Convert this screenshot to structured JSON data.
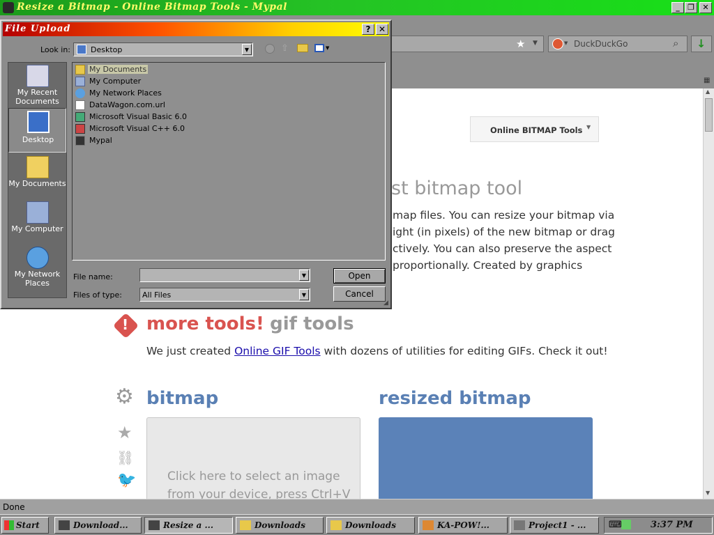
{
  "window": {
    "title": "Resize a Bitmap - Online Bitmap Tools - Mypal",
    "min_label": "_",
    "max_label": "❐",
    "close_label": "✕"
  },
  "toolbar": {
    "search_engine": "DuckDuckGo",
    "search_icon": "magnifier-icon",
    "bookmark_icon": "star-icon",
    "download_icon": "download-arrow-icon"
  },
  "page": {
    "dropdown_label": "Online BITMAP Tools",
    "heading_partial": "st bitmap tool",
    "intro_lines": [
      "map files. You can resize your bitmap via",
      "ight (in pixels) of the new bitmap or drag",
      "ctively. You can also preserve the aspect",
      "proportionally. Created by graphics"
    ],
    "more_tools_red": "more tools!",
    "more_tools_gray": "gif tools",
    "more_text_before": "We just created ",
    "more_link": "Online GIF Tools",
    "more_text_after": " with dozens of utilities for editing GIFs. Check it out!",
    "input_title": "bitmap",
    "output_title": "resized bitmap",
    "input_hint_line1": "Click here to select an image",
    "input_hint_line2": "from your device, press Ctrl+V"
  },
  "status": {
    "text": "Done"
  },
  "taskbar": {
    "start": "Start",
    "tasks": [
      "Download...",
      "Resize a ...",
      "Downloads",
      "Downloads",
      "KA-POW!...",
      "Project1 - ..."
    ],
    "clock": "3:37 PM"
  },
  "dialog": {
    "title": "File Upload",
    "help_label": "?",
    "close_label": "✕",
    "look_in_label": "Look in:",
    "look_in_value": "Desktop",
    "places": [
      "My Recent Documents",
      "Desktop",
      "My Documents",
      "My Computer",
      "My Network Places"
    ],
    "files": [
      {
        "name": "My Documents",
        "icon": "folder-icon",
        "selected": true
      },
      {
        "name": "My Computer",
        "icon": "computer-icon",
        "selected": false
      },
      {
        "name": "My Network Places",
        "icon": "network-icon",
        "selected": false
      },
      {
        "name": "DataWagon.com.url",
        "icon": "url-shortcut-icon",
        "selected": false
      },
      {
        "name": "Microsoft Visual Basic 6.0",
        "icon": "vb-shortcut-icon",
        "selected": false
      },
      {
        "name": "Microsoft Visual C++ 6.0",
        "icon": "vc-shortcut-icon",
        "selected": false
      },
      {
        "name": "Mypal",
        "icon": "mypal-shortcut-icon",
        "selected": false
      }
    ],
    "file_name_label": "File name:",
    "file_name_value": "",
    "file_type_label": "Files of type:",
    "file_type_value": "All Files",
    "open_label": "Open",
    "cancel_label": "Cancel"
  }
}
